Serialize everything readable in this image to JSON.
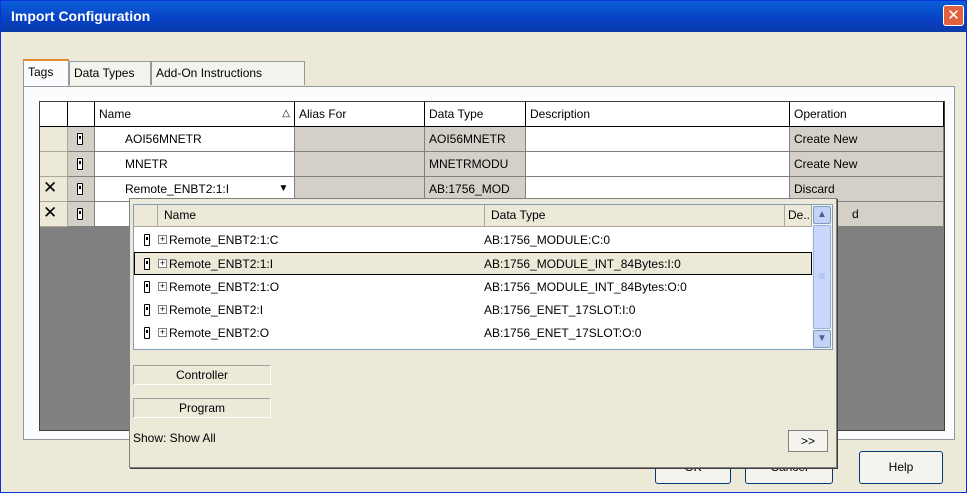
{
  "window": {
    "title": "Import Configuration",
    "close_glyph": "✕"
  },
  "tabs": [
    {
      "label": "Tags"
    },
    {
      "label": "Data Types"
    },
    {
      "label": "Add-On Instructions"
    }
  ],
  "grid": {
    "columns": [
      "Name",
      "Alias For",
      "Data Type",
      "Description",
      "Operation"
    ],
    "sort_glyph": "△",
    "rows": [
      {
        "name": "AOI56MNETR",
        "alias": "",
        "data_type": "AOI56MNETR",
        "description": "",
        "operation": "Create New"
      },
      {
        "name": "MNETR",
        "alias": "",
        "data_type": "MNETRMODU",
        "description": "",
        "operation": "Create New"
      },
      {
        "name": "Remote_ENBT2:1:I",
        "alias": "",
        "data_type": "AB:1756_MOD",
        "description": "",
        "operation": "Discard"
      },
      {
        "name": "",
        "alias": "",
        "data_type": "",
        "description": "",
        "operation": "d"
      }
    ],
    "dropdown_glyph": "▼"
  },
  "popup": {
    "columns": [
      "Name",
      "Data Type",
      "De..."
    ],
    "items": [
      {
        "name": "Remote_ENBT2:1:C",
        "data_type": "AB:1756_MODULE:C:0"
      },
      {
        "name": "Remote_ENBT2:1:I",
        "data_type": "AB:1756_MODULE_INT_84Bytes:I:0"
      },
      {
        "name": "Remote_ENBT2:1:O",
        "data_type": "AB:1756_MODULE_INT_84Bytes:O:0"
      },
      {
        "name": "Remote_ENBT2:I",
        "data_type": "AB:1756_ENET_17SLOT:I:0"
      },
      {
        "name": "Remote_ENBT2:O",
        "data_type": "AB:1756_ENET_17SLOT:O:0"
      }
    ],
    "expander_glyph": "+",
    "scroll_up_glyph": "▲",
    "scroll_down_glyph": "▼",
    "thumb_glyph": "≡",
    "controller_label": "Controller",
    "program_label": "Program",
    "show_label": "Show: Show All",
    "more_label": ">>"
  },
  "buttons": {
    "ok": "OK",
    "cancel": "Cancel",
    "help": "Help"
  }
}
